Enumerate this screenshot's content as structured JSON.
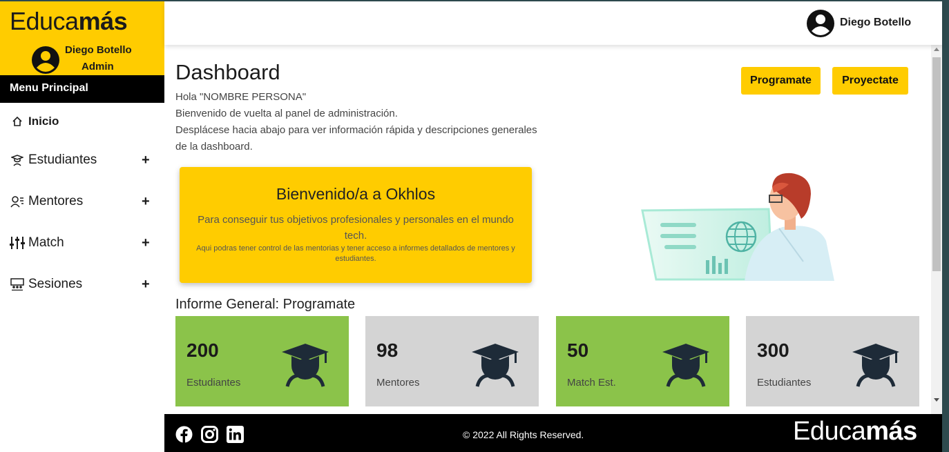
{
  "brand": {
    "logo_light": "Educa",
    "logo_bold": "más"
  },
  "sidebar": {
    "user_name": "Diego Botello",
    "user_role": "Admin",
    "menu_header": "Menu Principal",
    "items": [
      {
        "label": "Inicio",
        "icon": "home-icon"
      },
      {
        "label": "Estudiantes",
        "icon": "student-icon",
        "expand": "+"
      },
      {
        "label": "Mentores",
        "icon": "mentor-icon",
        "expand": "+"
      },
      {
        "label": "Match",
        "icon": "sliders-icon",
        "expand": "+"
      },
      {
        "label": "Sesiones",
        "icon": "presentation-icon",
        "expand": "+"
      }
    ]
  },
  "header": {
    "user_name": "Diego Botello"
  },
  "main": {
    "title": "Dashboard",
    "greeting": "Hola \"NOMBRE PERSONA\"",
    "line1": "Bienvenido de vuelta al panel de administración.",
    "line2": "Desplácese hacia abajo para ver información rápida y descripciones generales de la dashboard.",
    "btn_programate": "Programate",
    "btn_proyectate": "Proyectate",
    "welcome": {
      "title": "Bienvenido/a a Okhlos",
      "text": "Para conseguir tus objetivos profesionales y personales en el mundo tech.",
      "small": "Aqui podras tener control de las mentorias y tener acceso a informes detallados de mentores y estudiantes."
    },
    "section_title": "Informe General: Programate",
    "cards": [
      {
        "value": "200",
        "label": "Estudiantes",
        "color": "#8bc34a"
      },
      {
        "value": "98",
        "label": "Mentores",
        "color": "#d4d4d4"
      },
      {
        "value": "50",
        "label": "Match Est.",
        "color": "#8bc34a"
      },
      {
        "value": "300",
        "label": "Estudiantes",
        "color": "#d4d4d4"
      }
    ]
  },
  "footer": {
    "copyright": "© 2022 All Rights Reserved.",
    "logo_light": "Educa",
    "logo_bold": "más",
    "social": [
      "facebook-icon",
      "instagram-icon",
      "linkedin-icon"
    ]
  },
  "colors": {
    "accent": "#ffcc00",
    "green": "#8bc34a",
    "gray": "#d4d4d4",
    "dark": "#000000"
  }
}
